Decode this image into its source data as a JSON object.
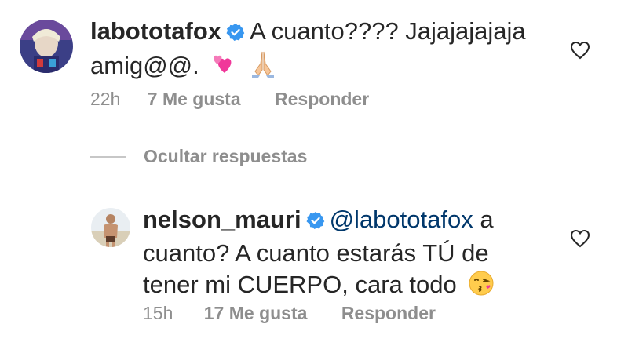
{
  "comments": [
    {
      "username": "labototafox",
      "verified": true,
      "text_line1": "A cuanto???? Jajajajajaja",
      "text_line2": "amig@@.",
      "emojis": [
        "two-hearts-icon",
        "folded-hands-icon"
      ],
      "time": "22h",
      "likes": "7 Me gusta",
      "reply_label": "Responder"
    }
  ],
  "replies_toggle": {
    "label": "Ocultar respuestas"
  },
  "reply": {
    "username": "nelson_mauri",
    "verified": true,
    "mention": "@labototafox",
    "text_line1_after_mention": "a",
    "text_line2": "cuanto? A cuanto estarás TÚ de",
    "text_line3": "tener mi CUERPO, cara todo",
    "emoji": "face-blowing-kiss-icon",
    "time": "15h",
    "likes": "17 Me gusta",
    "reply_label": "Responder"
  },
  "colors": {
    "text": "#262626",
    "secondary": "#8e8e8e",
    "mention": "#00376b",
    "verified": "#3897f0"
  }
}
